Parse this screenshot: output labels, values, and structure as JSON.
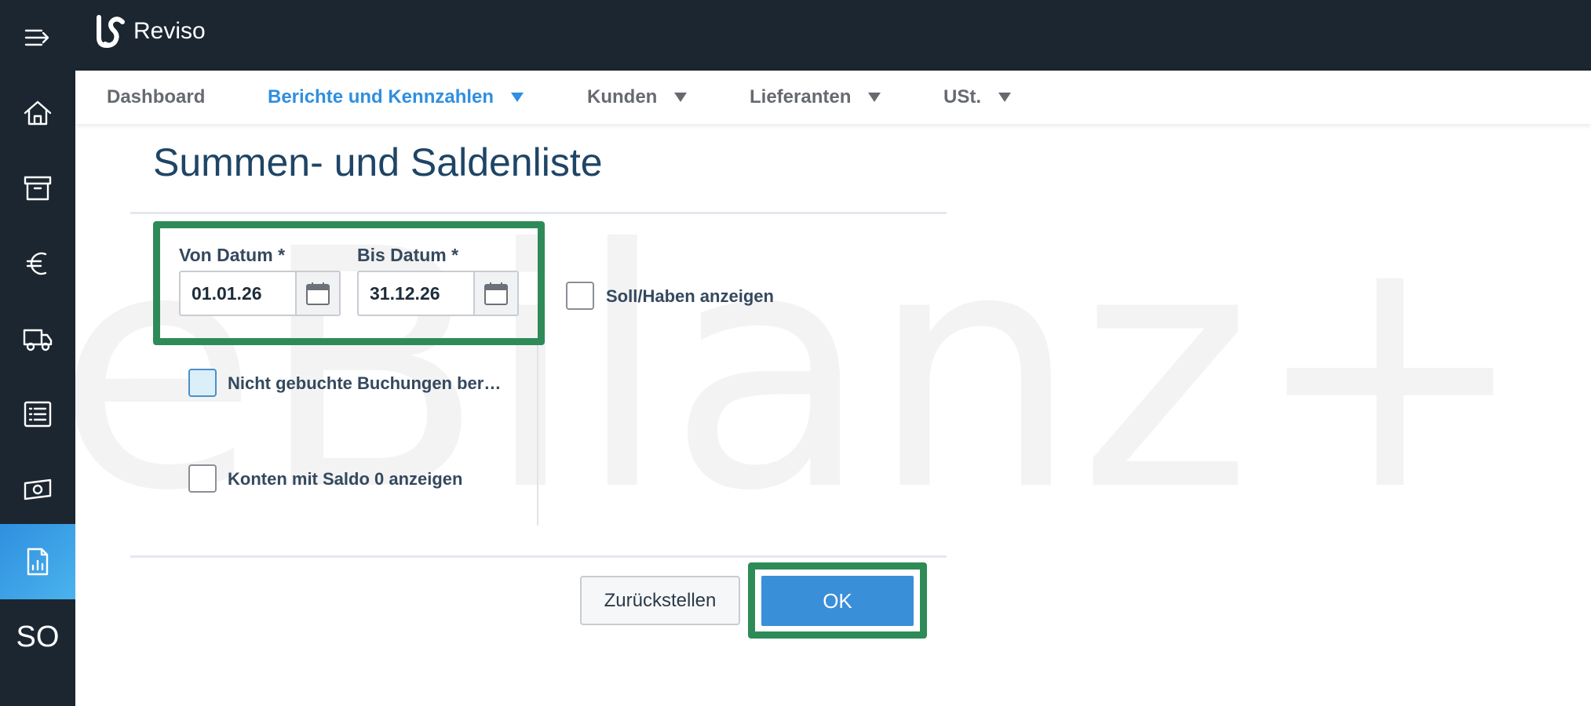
{
  "app": {
    "name": "Reviso"
  },
  "sidebar": {
    "items": [
      {
        "icon": "menu-collapse-icon"
      },
      {
        "icon": "home-icon"
      },
      {
        "icon": "archive-icon"
      },
      {
        "icon": "euro-icon"
      },
      {
        "icon": "truck-icon"
      },
      {
        "icon": "list-icon"
      },
      {
        "icon": "cash-icon"
      },
      {
        "icon": "report-icon",
        "active": true
      },
      {
        "label": "SO"
      }
    ]
  },
  "nav": {
    "items": [
      {
        "label": "Dashboard",
        "dropdown": false
      },
      {
        "label": "Berichte und Kennzahlen",
        "dropdown": true,
        "active": true
      },
      {
        "label": "Kunden",
        "dropdown": true
      },
      {
        "label": "Lieferanten",
        "dropdown": true
      },
      {
        "label": "USt.",
        "dropdown": true
      }
    ]
  },
  "page": {
    "title": "Summen- und Saldenliste",
    "watermark": "eBilanz+"
  },
  "form": {
    "von_datum": {
      "label": "Von Datum *",
      "value": "01.01.26"
    },
    "bis_datum": {
      "label": "Bis Datum *",
      "value": "31.12.26"
    },
    "checkboxes": [
      {
        "label": "Soll/Haben anzeigen",
        "checked": false
      },
      {
        "label": "Nicht gebuchte Buchungen ber…",
        "checked": false,
        "focused": true
      },
      {
        "label": "Konten mit Saldo 0 anzeigen",
        "checked": false
      }
    ],
    "reset_label": "Zurückstellen",
    "ok_label": "OK"
  },
  "colors": {
    "sidebar_bg": "#1b2631",
    "accent": "#2f8fe0",
    "highlight": "#2e8b57",
    "primary_button": "#3a8fd9",
    "title": "#1f4566"
  }
}
